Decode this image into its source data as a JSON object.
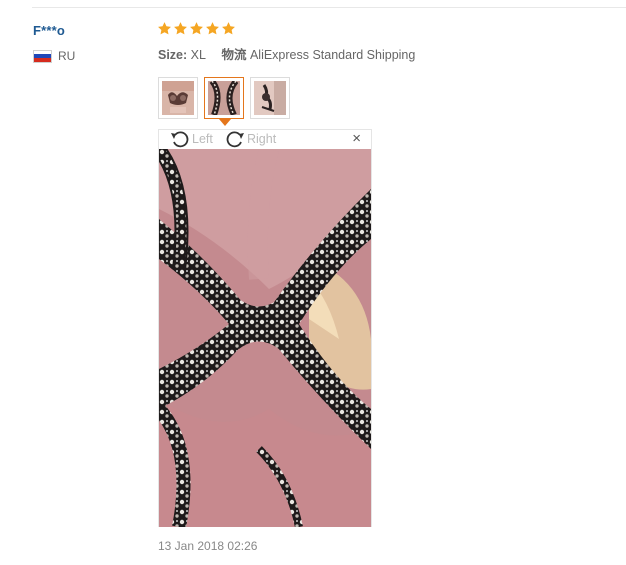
{
  "review": {
    "user_name": "F***o",
    "country_code": "RU",
    "rating": 5,
    "size_label": "Size:",
    "size_value": "XL",
    "shipping_label": "物流",
    "shipping_value": "AliExpress Standard Shipping",
    "date": "13 Jan 2018 02:26"
  },
  "viewer": {
    "rotate_left_label": "Left",
    "rotate_right_label": "Right",
    "close_label": "×",
    "thumbnails": [
      {
        "name": "review-photo-1",
        "active": false
      },
      {
        "name": "review-photo-2",
        "active": true
      },
      {
        "name": "review-photo-3",
        "active": false
      }
    ]
  },
  "colors": {
    "star": "#f5a623",
    "user_name": "#1f5a92",
    "active_border": "#e4761c",
    "muted_text": "#bbbbbb"
  }
}
